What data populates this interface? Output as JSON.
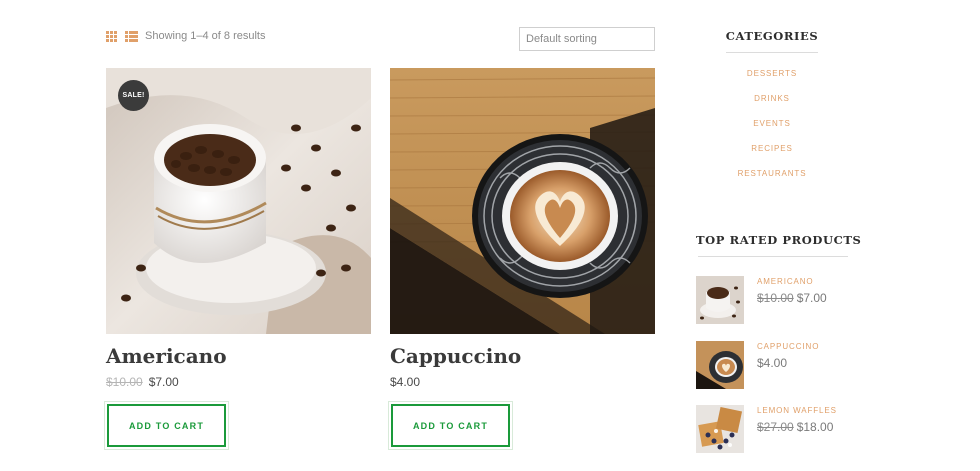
{
  "toolbar": {
    "result_count": "Showing 1–4 of 8 results",
    "sort_value": "Default sorting",
    "icons": [
      "grid-view-icon",
      "list-view-icon"
    ]
  },
  "products": [
    {
      "title": "Americano",
      "sale_badge": "SALE!",
      "old_price": "$10.00",
      "price": "$7.00",
      "button": "ADD TO CART",
      "image": "cup of coffee beans"
    },
    {
      "title": "Cappuccino",
      "old_price": "",
      "price": "$4.00",
      "button": "ADD TO CART",
      "image": "cappuccino with latte art"
    }
  ],
  "sidebar": {
    "categories_title": "CATEGORIES",
    "categories": [
      "DESSERTS",
      "DRINKS",
      "EVENTS",
      "RECIPES",
      "RESTAURANTS"
    ],
    "top_rated_title": "TOP RATED PRODUCTS",
    "top_rated": [
      {
        "name": "AMERICANO",
        "old_price": "$10.00",
        "price": "$7.00"
      },
      {
        "name": "CAPPUCCINO",
        "old_price": "",
        "price": "$4.00"
      },
      {
        "name": "LEMON WAFFLES",
        "old_price": "$27.00",
        "price": "$18.00"
      }
    ]
  },
  "colors": {
    "accent": "#e0a06a",
    "button": "#1a9a3a",
    "badge": "#3b3b3b",
    "heading": "#3a3a3a"
  }
}
